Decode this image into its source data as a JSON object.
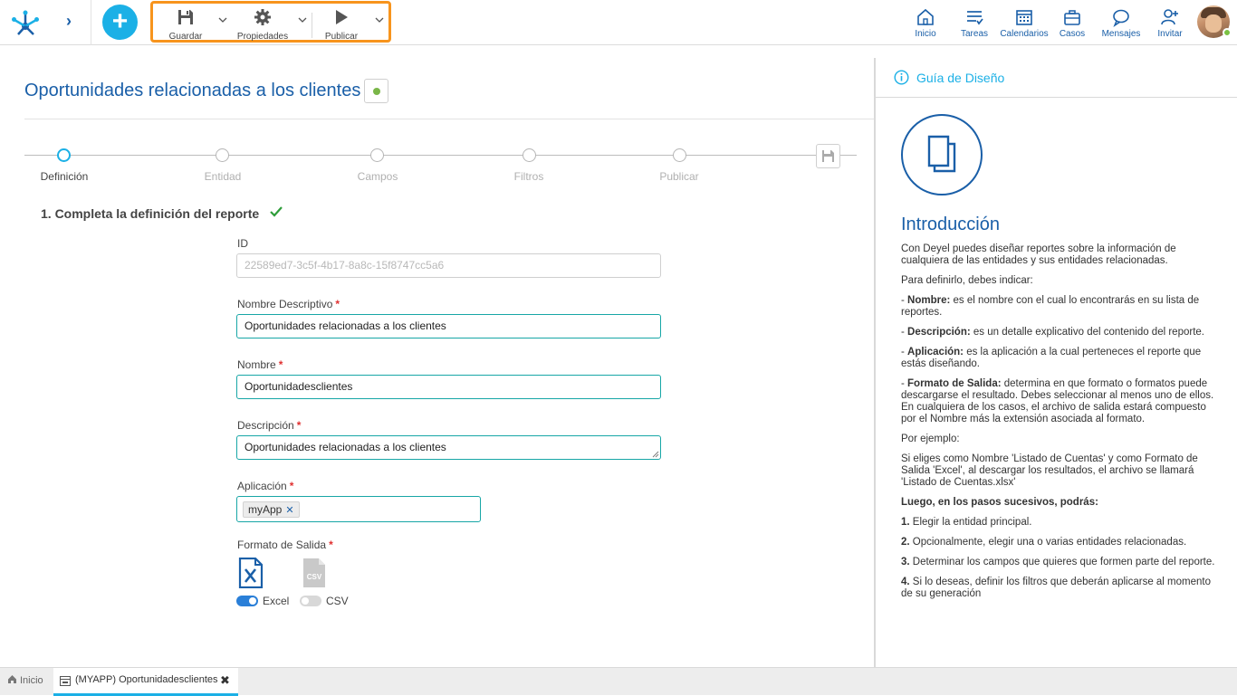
{
  "toolbar": {
    "save_label": "Guardar",
    "properties_label": "Propiedades",
    "publish_label": "Publicar"
  },
  "nav": {
    "home": "Inicio",
    "tasks": "Tareas",
    "calendars": "Calendarios",
    "cases": "Casos",
    "messages": "Mensajes",
    "invite": "Invitar"
  },
  "page": {
    "title": "Oportunidades relacionadas a los clientes",
    "steps": [
      "Definición",
      "Entidad",
      "Campos",
      "Filtros",
      "Publicar"
    ],
    "section_title": "1. Completa la definición del reporte"
  },
  "form": {
    "id_label": "ID",
    "id_value": "22589ed7-3c5f-4b17-8a8c-15f8747cc5a6",
    "descriptive_name_label": "Nombre Descriptivo",
    "descriptive_name_value": "Oportunidades relacionadas a los clientes",
    "name_label": "Nombre",
    "name_value": "Oportunidadesclientes",
    "description_label": "Descripción",
    "description_value": "Oportunidades relacionadas a los clientes",
    "application_label": "Aplicación",
    "application_tag": "myApp",
    "output_format_label": "Formato de Salida",
    "required_mark": "*",
    "formats": {
      "excel_label": "Excel",
      "excel_enabled": true,
      "csv_label": "CSV",
      "csv_enabled": false
    }
  },
  "guide": {
    "header": "Guía de Diseño",
    "heading": "Introducción",
    "p1": "Con Deyel puedes diseñar reportes sobre la información de cualquiera de las entidades y sus entidades relacionadas.",
    "p2": "Para definirlo, debes indicar:",
    "b_nombre": "Nombre:",
    "t_nombre": " es el nombre con el cual lo encontrarás en su lista de reportes.",
    "b_desc": "Descripción:",
    "t_desc": " es un detalle explicativo del contenido del reporte.",
    "b_app": "Aplicación:",
    "t_app": " es la aplicación a la cual perteneces el reporte que estás diseñando.",
    "b_fmt": "Formato de Salida:",
    "t_fmt": " determina en que formato o formatos puede descargarse el resultado. Debes seleccionar al menos uno de ellos. En cualquiera de los casos, el archivo de salida estará compuesto por el Nombre más la extensión asociada al formato.",
    "p_example": "Por ejemplo:",
    "p_example_text": "Si eliges como Nombre 'Listado de Cuentas' y como Formato de Salida 'Excel', al descargar los resultados, el archivo se llamará 'Listado de Cuentas.xlsx'",
    "p_next": "Luego, en los pasos sucesivos, podrás:",
    "s1_num": "1.",
    "s1": " Elegir la entidad principal.",
    "s2_num": "2.",
    "s2": " Opcionalmente, elegir una o varias entidades relacionadas.",
    "s3_num": "3.",
    "s3": " Determinar los campos que quieres que formen parte del reporte.",
    "s4_num": "4.",
    "s4": " Si lo deseas, definir los filtros que deberán aplicarse al momento de su generación",
    "dash": "- "
  },
  "bottom": {
    "home_tab": "Inicio",
    "active_tab": "(MYAPP) Oportunidadesclientes",
    "close": "✖"
  },
  "colors": {
    "primary": "#1a5fa8",
    "accent": "#1bb0e6",
    "highlight": "#f7941d",
    "focus": "#17a6a6",
    "required": "#e03131"
  }
}
